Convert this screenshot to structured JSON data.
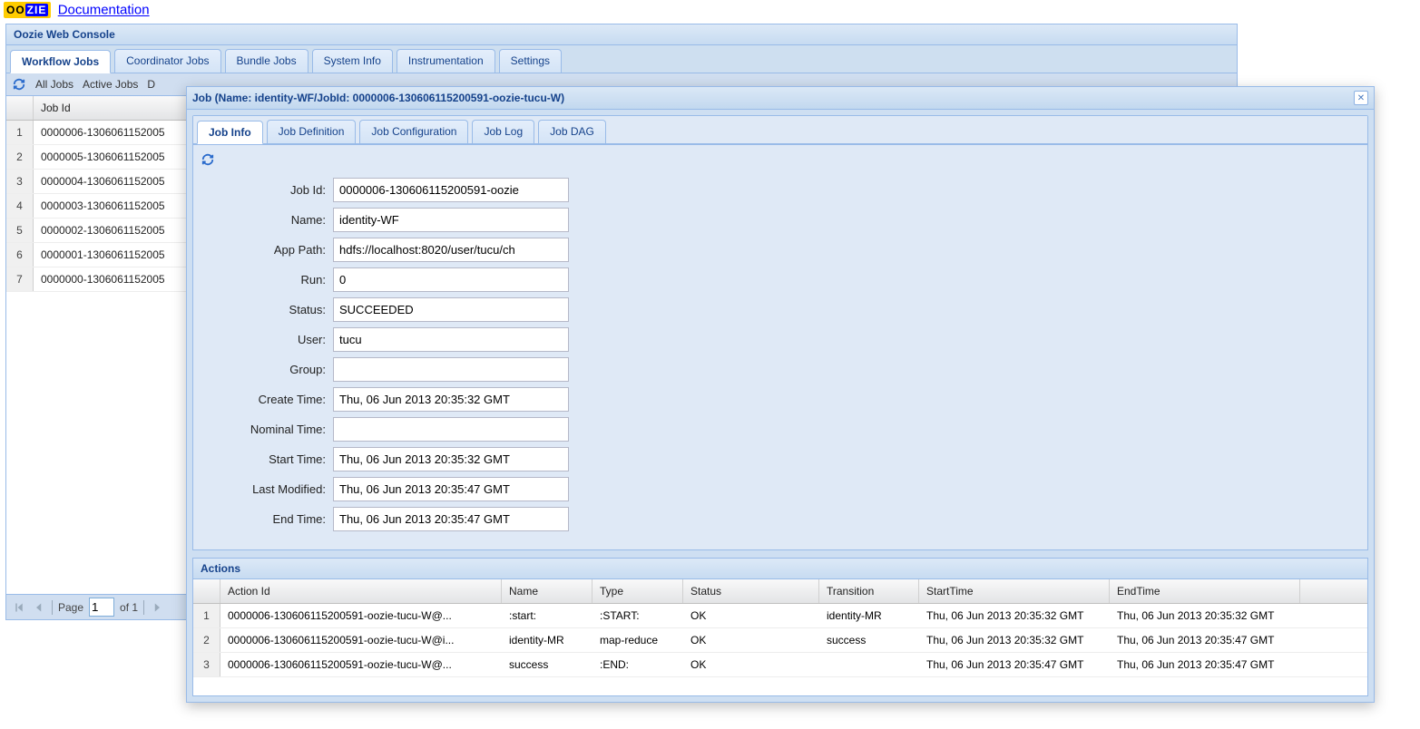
{
  "header": {
    "doc_link": "Documentation",
    "console_title": "Oozie Web Console"
  },
  "main_tabs": [
    "Workflow Jobs",
    "Coordinator Jobs",
    "Bundle Jobs",
    "System Info",
    "Instrumentation",
    "Settings"
  ],
  "filters": {
    "all": "All Jobs",
    "active": "Active Jobs",
    "partial": "D"
  },
  "jobs_grid": {
    "header": "Job Id",
    "rows": [
      "0000006-1306061152005",
      "0000005-1306061152005",
      "0000004-1306061152005",
      "0000003-1306061152005",
      "0000002-1306061152005",
      "0000001-1306061152005",
      "0000000-1306061152005"
    ]
  },
  "paging": {
    "page_label": "Page",
    "page_value": "1",
    "of_label": "of 1"
  },
  "job_window": {
    "title": "Job (Name: identity-WF/JobId: 0000006-130606115200591-oozie-tucu-W)",
    "tabs": [
      "Job Info",
      "Job Definition",
      "Job Configuration",
      "Job Log",
      "Job DAG"
    ],
    "fields": {
      "job_id_label": "Job Id:",
      "job_id": "0000006-130606115200591-oozie",
      "name_label": "Name:",
      "name": "identity-WF",
      "app_path_label": "App Path:",
      "app_path": "hdfs://localhost:8020/user/tucu/ch",
      "run_label": "Run:",
      "run": "0",
      "status_label": "Status:",
      "status": "SUCCEEDED",
      "user_label": "User:",
      "user": "tucu",
      "group_label": "Group:",
      "group": "",
      "create_time_label": "Create Time:",
      "create_time": "Thu, 06 Jun 2013 20:35:32 GMT",
      "nominal_time_label": "Nominal Time:",
      "nominal_time": "",
      "start_time_label": "Start Time:",
      "start_time": "Thu, 06 Jun 2013 20:35:32 GMT",
      "last_modified_label": "Last Modified:",
      "last_modified": "Thu, 06 Jun 2013 20:35:47 GMT",
      "end_time_label": "End Time:",
      "end_time": "Thu, 06 Jun 2013 20:35:47 GMT"
    },
    "actions": {
      "title": "Actions",
      "columns": [
        "Action Id",
        "Name",
        "Type",
        "Status",
        "Transition",
        "StartTime",
        "EndTime"
      ],
      "rows": [
        {
          "id": "0000006-130606115200591-oozie-tucu-W@...",
          "name": ":start:",
          "type": ":START:",
          "status": "OK",
          "transition": "identity-MR",
          "start": "Thu, 06 Jun 2013 20:35:32 GMT",
          "end": "Thu, 06 Jun 2013 20:35:32 GMT"
        },
        {
          "id": "0000006-130606115200591-oozie-tucu-W@i...",
          "name": "identity-MR",
          "type": "map-reduce",
          "status": "OK",
          "transition": "success",
          "start": "Thu, 06 Jun 2013 20:35:32 GMT",
          "end": "Thu, 06 Jun 2013 20:35:47 GMT"
        },
        {
          "id": "0000006-130606115200591-oozie-tucu-W@...",
          "name": "success",
          "type": ":END:",
          "status": "OK",
          "transition": "",
          "start": "Thu, 06 Jun 2013 20:35:47 GMT",
          "end": "Thu, 06 Jun 2013 20:35:47 GMT"
        }
      ]
    }
  }
}
